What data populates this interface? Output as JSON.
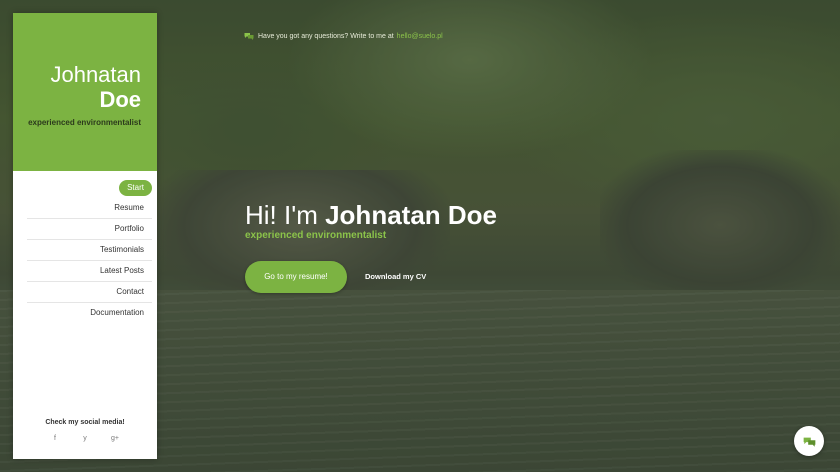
{
  "sidebar": {
    "first_name": "Johnatan",
    "last_name": "Doe",
    "role": "experienced environmentalist",
    "nav": [
      {
        "label": "Start",
        "active": true
      },
      {
        "label": "Resume",
        "active": false
      },
      {
        "label": "Portfolio",
        "active": false
      },
      {
        "label": "Testimonials",
        "active": false
      },
      {
        "label": "Latest Posts",
        "active": false
      },
      {
        "label": "Contact",
        "active": false
      },
      {
        "label": "Documentation",
        "active": false
      }
    ],
    "social_title": "Check my social media!",
    "social_icons": [
      {
        "name": "facebook-icon",
        "glyph": "f"
      },
      {
        "name": "twitter-icon",
        "glyph": "y"
      },
      {
        "name": "google-plus-icon",
        "glyph": "g+"
      }
    ]
  },
  "topbar": {
    "question": "Have you got any questions? Write to me at",
    "email": "hello@suelo.pl"
  },
  "hero": {
    "greeting": "Hi! I'm",
    "name": "Johnatan Doe",
    "subtitle": "experienced environmentalist",
    "resume_button": "Go to my resume!",
    "cv_link": "Download my CV"
  },
  "colors": {
    "accent": "#7cb342",
    "accent_text": "#8bc34a"
  }
}
